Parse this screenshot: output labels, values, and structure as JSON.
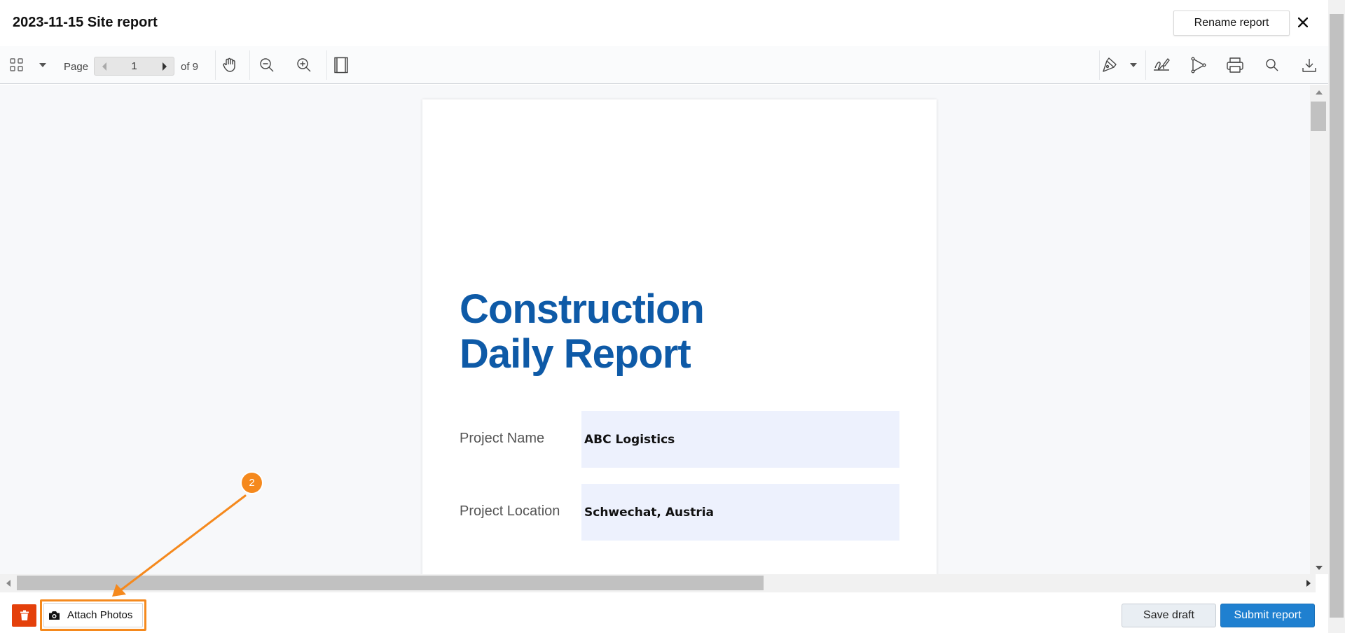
{
  "header": {
    "title": "2023-11-15 Site report",
    "rename_label": "Rename report"
  },
  "toolbar": {
    "page_label": "Page",
    "current_page": "1",
    "of_label": "of 9",
    "icons": [
      "thumbnails-icon",
      "dropdown-icon",
      "pan-hand-icon",
      "zoom-out-icon",
      "zoom-in-icon",
      "fit-page-icon",
      "annotate-pen-icon",
      "dropdown-icon",
      "signature-icon",
      "share-icon",
      "print-icon",
      "search-icon",
      "download-icon"
    ]
  },
  "document": {
    "heading_line1": "Construction",
    "heading_line2": "Daily Report",
    "fields": [
      {
        "label": "Project Name",
        "value": "ABC Logistics"
      },
      {
        "label": "Project Location",
        "value": "Schwechat, Austria"
      }
    ]
  },
  "footer": {
    "attach_label": "Attach Photos",
    "save_draft_label": "Save draft",
    "submit_label": "Submit report"
  },
  "annotation": {
    "step_number": "2",
    "color": "#f5891d"
  },
  "colors": {
    "brand_blue": "#0e5aa7",
    "primary_button": "#1f80d0",
    "delete_red": "#e4400b",
    "field_bg": "#edf1fd"
  }
}
